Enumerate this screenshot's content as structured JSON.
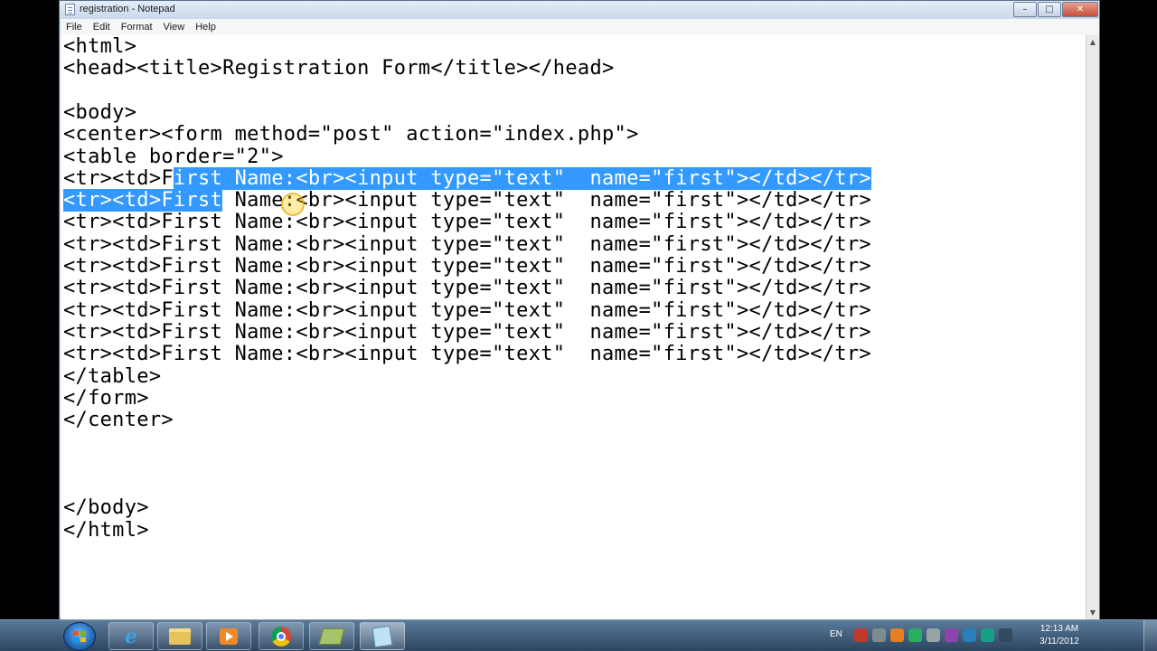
{
  "window": {
    "title": "registration - Notepad",
    "controls": {
      "minimize": "–",
      "maximize": "□",
      "close": "✕"
    }
  },
  "menu": [
    "File",
    "Edit",
    "Format",
    "View",
    "Help"
  ],
  "editor": {
    "lines": [
      {
        "text": "<html>"
      },
      {
        "text": "<head><title>Registration Form</title></head>"
      },
      {
        "text": ""
      },
      {
        "text": "<body>"
      },
      {
        "text": "<center><form method=\"post\" action=\"index.php\">"
      },
      {
        "text": "<table border=\"2\">"
      },
      {
        "before": "<tr><td>F",
        "selected": "irst Name:<br><input type=\"text\"  name=\"first\"></td></tr>",
        "after": ""
      },
      {
        "before": "",
        "selected": "<tr><td>First",
        "after": " Name:<br><input type=\"text\"  name=\"first\"></td></tr>"
      },
      {
        "text": "<tr><td>First Name:<br><input type=\"text\"  name=\"first\"></td></tr>"
      },
      {
        "text": "<tr><td>First Name:<br><input type=\"text\"  name=\"first\"></td></tr>"
      },
      {
        "text": "<tr><td>First Name:<br><input type=\"text\"  name=\"first\"></td></tr>"
      },
      {
        "text": "<tr><td>First Name:<br><input type=\"text\"  name=\"first\"></td></tr>"
      },
      {
        "text": "<tr><td>First Name:<br><input type=\"text\"  name=\"first\"></td></tr>"
      },
      {
        "text": "<tr><td>First Name:<br><input type=\"text\"  name=\"first\"></td></tr>"
      },
      {
        "text": "<tr><td>First Name:<br><input type=\"text\"  name=\"first\"></td></tr>"
      },
      {
        "text": "</table>"
      },
      {
        "text": "</form>"
      },
      {
        "text": "</center>"
      },
      {
        "text": ""
      },
      {
        "text": ""
      },
      {
        "text": ""
      },
      {
        "text": "</body>"
      },
      {
        "text": "</html>"
      }
    ]
  },
  "taskbar": {
    "language": "EN",
    "clock_time": "12:13 AM",
    "clock_date": "3/11/2012",
    "apps": [
      "internet-explorer-icon",
      "folder-icon",
      "media-player-icon",
      "chrome-icon",
      "stack-icon",
      "notepad-icon"
    ]
  },
  "colors": {
    "selection": "#3399ff",
    "taskbar": "#2c4560"
  }
}
